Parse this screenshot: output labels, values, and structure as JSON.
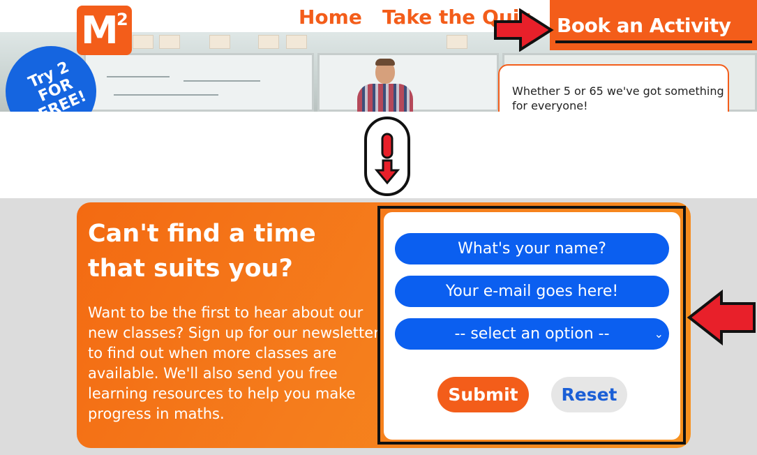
{
  "site": {
    "logo_text": "M",
    "logo_superscript": "2",
    "badge_line1": "Try 2",
    "badge_line2": "FOR",
    "badge_line3": "FREE!",
    "nav": {
      "home": "Home",
      "quiz": "Take the Quiz",
      "book": "Book an Activity"
    },
    "info_card_text": "Whether 5 or 65 we've got something for everyone!"
  },
  "signup": {
    "title_line1": "Can't find a time",
    "title_line2": "that suits you?",
    "body": "Want to be the first to hear about our new classes? Sign up for our newsletter to find out when more classes are available. We'll also send you free learning resources to help you make progress in maths.",
    "name_placeholder": "What's your name?",
    "email_placeholder": "Your e-mail goes here!",
    "select_value": "-- select an option --",
    "submit_label": "Submit",
    "reset_label": "Reset"
  },
  "colors": {
    "brand_orange": "#f35d1a",
    "field_blue": "#0b5ff0",
    "annotation_red": "#e8202a"
  },
  "icons": {
    "scroll": "mouse-scroll-down-icon",
    "pointer_arrow": "red-arrow-icon",
    "chevron": "chevron-down-icon"
  }
}
